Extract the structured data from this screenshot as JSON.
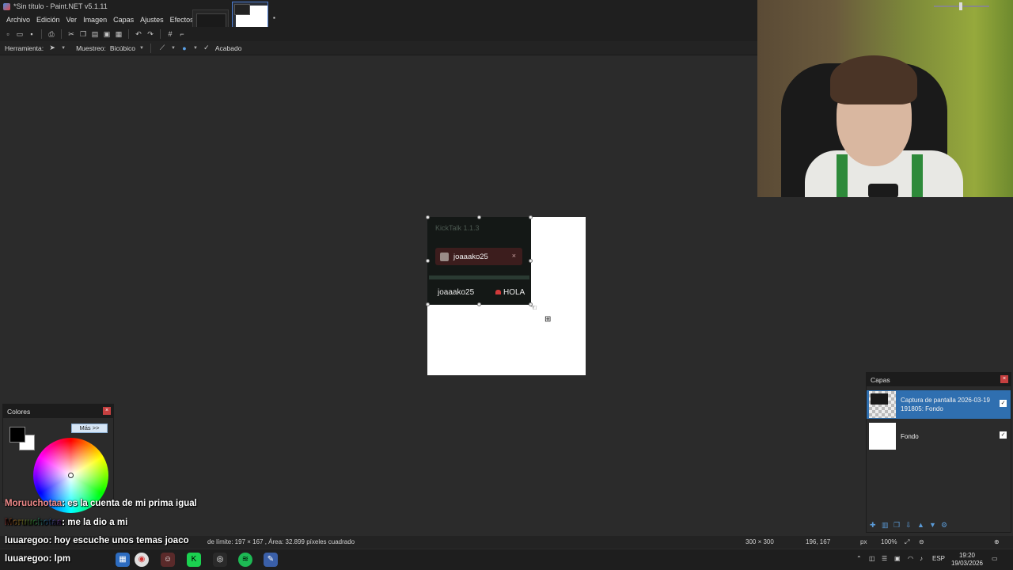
{
  "window": {
    "title": "*Sin título - Paint.NET v5.1.11"
  },
  "menu": [
    "Archivo",
    "Edición",
    "Ver",
    "Imagen",
    "Capas",
    "Ajustes",
    "Efectos"
  ],
  "options_bar": {
    "tool_label": "Herramienta:",
    "sampling_label": "Muestreo:",
    "sampling_value": "Bicúbico",
    "finish_label": "Acabado"
  },
  "canvas_content": {
    "app_title": "KickTalk 1.1.3",
    "tab_name": "joaaako25",
    "tab_close": "×",
    "msg_user": "joaaako25",
    "msg_text": "HOLA"
  },
  "colors_panel": {
    "title": "Colores",
    "more_button": "Más >>",
    "close": "×"
  },
  "layers_panel": {
    "title": "Capas",
    "close": "×",
    "layers": [
      {
        "name": "Captura de pantalla 2026-03-19 191805: Fondo",
        "visible": true,
        "selected": true
      },
      {
        "name": "Fondo",
        "visible": true,
        "selected": false
      }
    ]
  },
  "chat": [
    {
      "user": "Moruuchotaa",
      "message": ": es la cuenta de mi prima igual"
    },
    {
      "user": "Moruuchotaa",
      "message": ": me la dio a mi"
    },
    {
      "user": "luuaregoo",
      "message": ": hoy escuche unos temas joaco"
    },
    {
      "user": "luuaregoo",
      "message": ": lpm"
    }
  ],
  "status_bar": {
    "selection_info": "de límite: 197 × 167 , Área: 32.899 píxeles cuadrado",
    "image_size": "300 × 300",
    "cursor_pos": "196, 167",
    "unit": "px",
    "zoom": "100%"
  },
  "taskbar": {
    "language": "ESP",
    "time": "19:20",
    "date": "19/03/2026"
  },
  "colors": {
    "accent": "#2f6fb0",
    "close_red": "#c64040",
    "primary_color": "#000000",
    "secondary_color": "#ffffff"
  }
}
